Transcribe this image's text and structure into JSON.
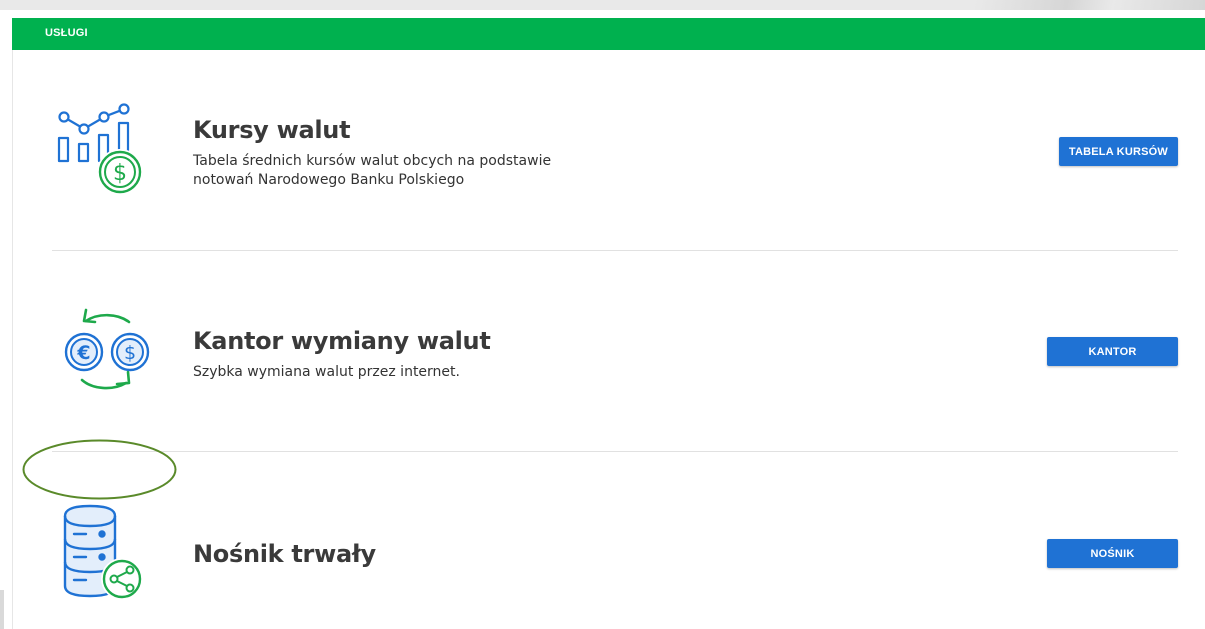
{
  "header": {
    "title": "USŁUGI"
  },
  "services": [
    {
      "icon": "chart-dollar-icon",
      "title": "Kursy walut",
      "description_lines": [
        "Tabela średnich kursów walut obcych na podstawie",
        "notowań Narodowego Banku Polskiego"
      ],
      "button": "TABELA KURSÓW"
    },
    {
      "icon": "currency-exchange-icon",
      "title": "Kantor wymiany walut",
      "description_lines": [
        "Szybka wymiana walut przez internet."
      ],
      "button": "KANTOR"
    },
    {
      "icon": "database-share-icon",
      "title": "Nośnik trwały",
      "description_lines": [],
      "button": "NOŚNIK"
    }
  ],
  "colors": {
    "header_green": "#00b14f",
    "button_blue": "#1f72d4",
    "icon_blue": "#1f72d4",
    "icon_green": "#1ea94b",
    "annotation_green": "#5a8a2a"
  }
}
